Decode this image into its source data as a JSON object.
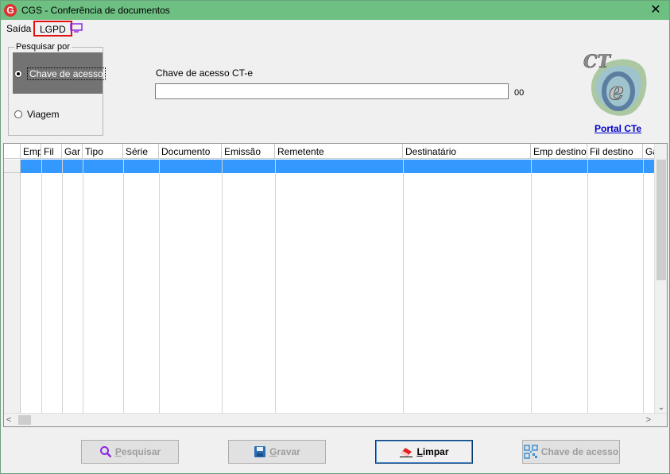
{
  "window": {
    "title": "CGS - Conferência de documentos",
    "logo_letter": "G",
    "close_glyph": "✕"
  },
  "menu": {
    "saida": "Saída",
    "lgpd": "LGPD",
    "monitor_icon": "monitor-icon"
  },
  "search_by": {
    "legend": "Pesquisar por",
    "options": [
      {
        "label": "Chave de acesso",
        "selected": true
      },
      {
        "label": "Viagem",
        "selected": false
      }
    ]
  },
  "chave": {
    "label": "Chave de acesso CT-e",
    "value": "",
    "suffix": "00"
  },
  "portal": {
    "logo_text": "CT e",
    "link": "Portal CTe"
  },
  "grid": {
    "columns": [
      "Emp",
      "Fil",
      "Gar",
      "Tipo",
      "Série",
      "Documento",
      "Emissão",
      "Remetente",
      "Destinatário",
      "Emp destino",
      "Fil destino",
      "Ga"
    ],
    "rows": []
  },
  "buttons": {
    "pesquisar": {
      "underline": "P",
      "rest": "esquisar",
      "enabled": false,
      "icon": "search-icon"
    },
    "gravar": {
      "underline": "G",
      "rest": "ravar",
      "enabled": false,
      "icon": "save-icon"
    },
    "limpar": {
      "underline": "L",
      "rest": "impar",
      "enabled": true,
      "icon": "eraser-icon"
    },
    "chave": {
      "label": "Chave de acesso",
      "enabled": false,
      "icon": "qr-icon"
    }
  },
  "colors": {
    "titlebar": "#6dbf82",
    "selection": "#3399ff",
    "lgpd_highlight": "#e01010",
    "link": "#0000cc"
  }
}
